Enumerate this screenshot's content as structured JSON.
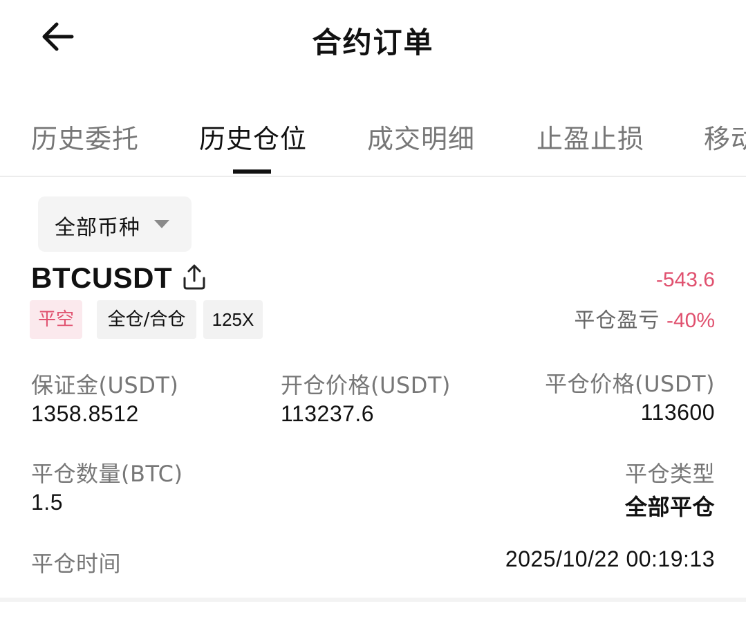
{
  "header": {
    "title": "合约订单",
    "back_icon": "arrow-left-icon"
  },
  "tabs": [
    {
      "label": "历史委托",
      "active": false
    },
    {
      "label": "历史仓位",
      "active": true
    },
    {
      "label": "成交明细",
      "active": false
    },
    {
      "label": "止盈止损",
      "active": false
    },
    {
      "label": "移动",
      "active": false
    }
  ],
  "filter": {
    "label": "全部币种",
    "icon": "caret-down-icon"
  },
  "position": {
    "symbol": "BTCUSDT",
    "share_icon": "share-icon",
    "pnl": "-543.6",
    "pnl_rate_label": "平仓盈亏",
    "pnl_rate": "-40%",
    "tags": {
      "side": "平空",
      "margin_mode": "全仓/合仓",
      "leverage": "125X"
    },
    "margin_label": "保证金(USDT)",
    "margin_value": "1358.8512",
    "open_price_label": "开仓价格(USDT)",
    "open_price_value": "113237.6",
    "close_price_label": "平仓价格(USDT)",
    "close_price_value": "113600",
    "close_qty_label": "平仓数量(BTC)",
    "close_qty_value": "1.5",
    "close_type_label": "平仓类型",
    "close_type_value": "全部平仓",
    "close_time_label": "平仓时间",
    "close_time_value": "2025/10/22 00:19:13"
  },
  "colors": {
    "loss": "#e0516f",
    "text_primary": "#111111",
    "text_secondary": "#777777"
  }
}
